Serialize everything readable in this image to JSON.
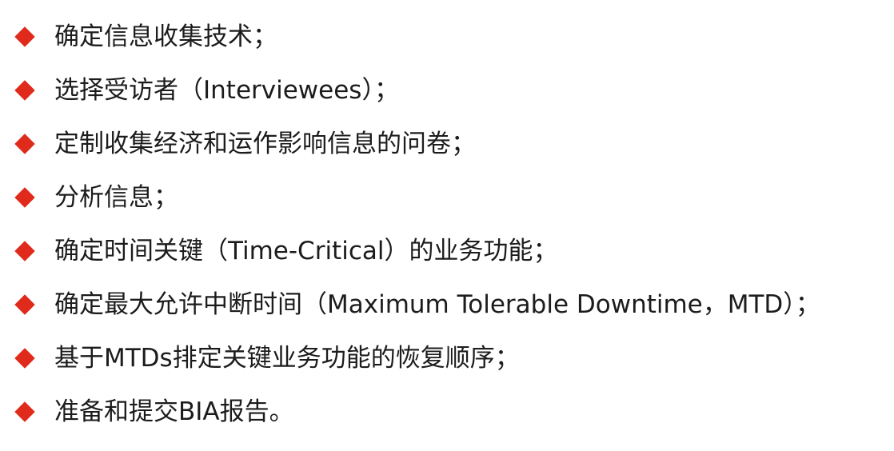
{
  "colors": {
    "bullet": "#e02a1b",
    "text": "#1c1c1c",
    "background": "#ffffff"
  },
  "bullet_icon": "red-diamond-icon",
  "items": [
    {
      "text": "确定信息收集技术；"
    },
    {
      "text": "选择受访者（Interviewees）；"
    },
    {
      "text": "定制收集经济和运作影响信息的问卷；"
    },
    {
      "text": "分析信息；"
    },
    {
      "text": "确定时间关键（Time-Critical）的业务功能；"
    },
    {
      "text": "确定最大允许中断时间（Maximum Tolerable Downtime，MTD）；"
    },
    {
      "text": "基于MTDs排定关键业务功能的恢复顺序；"
    },
    {
      "text": "准备和提交BIA报告。"
    }
  ]
}
